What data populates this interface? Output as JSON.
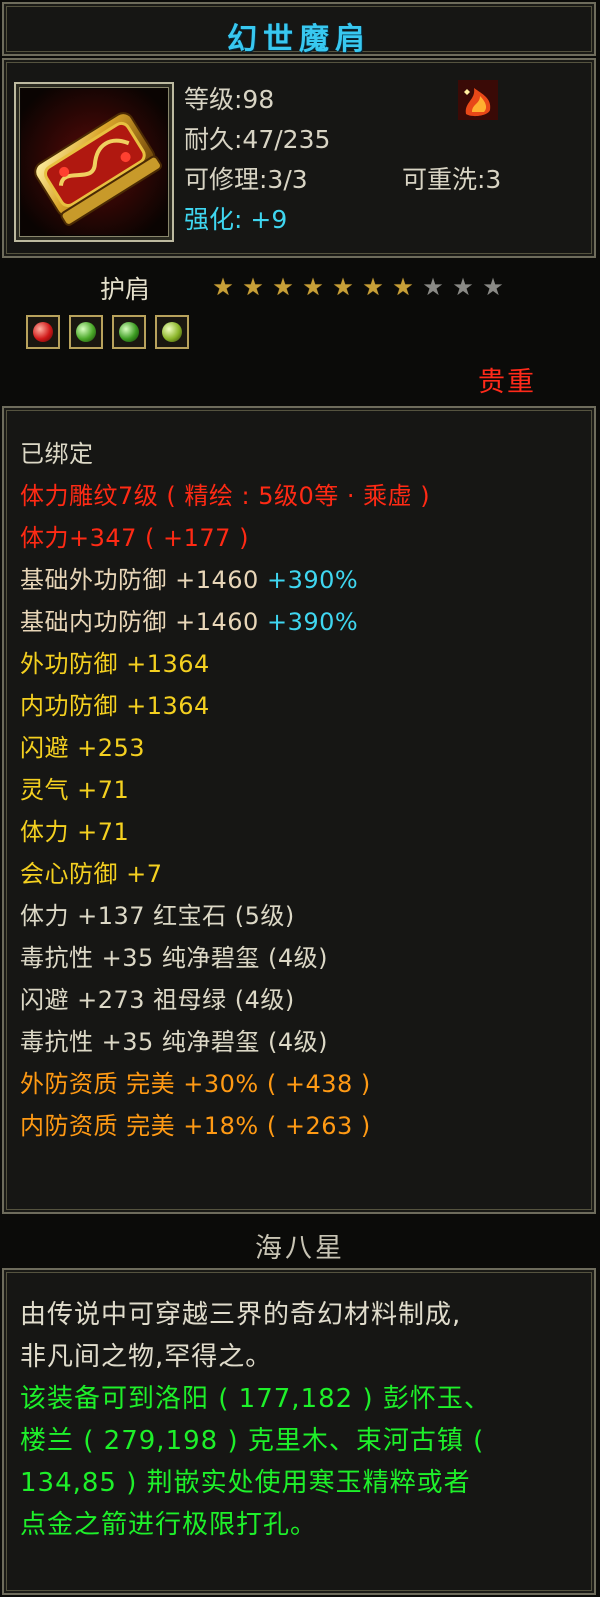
{
  "item": {
    "name": "幻世魔肩",
    "level": "等级:98",
    "durability": "耐久:47/235",
    "repairable": "可修理:3/3",
    "rewashable": "可重洗:3",
    "enhance": "强化: +9",
    "slot_type": "护肩",
    "stars_total": 10,
    "stars_filled": 7,
    "rarity": "贵重",
    "gem_slots": [
      "red",
      "green",
      "green",
      "yellow-green"
    ],
    "icon": "golden-shoulder-armor-icon",
    "mini_icon": "flame-buff-icon"
  },
  "attributes": {
    "bound": "已绑定",
    "engrave": "体力雕纹7级 ( 精绘 : 5级0等 · 乘虚 )",
    "vit_bonus": "体力+347 ( +177 )",
    "base_ext_def": "基础外功防御 +1460 ",
    "base_ext_def_pct": "+390%",
    "base_int_def": "基础内功防御 +1460 ",
    "base_int_def_pct": "+390%",
    "ext_def": "外功防御 +1364",
    "int_def": "内功防御 +1364",
    "dodge": "闪避 +253",
    "spirit": "灵气 +71",
    "vit": "体力 +71",
    "crit_def": "会心防御 +7",
    "gem1": "体力 +137 红宝石 (5级)",
    "gem2": "毒抗性 +35 纯净碧玺 (4级)",
    "gem3": "闪避 +273 祖母绿 (4级)",
    "gem4": "毒抗性 +35 纯净碧玺 (4级)",
    "apt_ext": "外防资质  完美 +30% ( +438 )",
    "apt_int": "内防资质  完美 +18% ( +263 )"
  },
  "set_name": "海八星",
  "description": {
    "line1": "由传说中可穿越三界的奇幻材料制成,",
    "line2": "非凡间之物,罕得之。",
    "line3": "该装备可到洛阳 ( 177,182 ) 彭怀玉、",
    "line4": "楼兰 ( 279,198 ) 克里木、束河古镇 (",
    "line5": "134,85 ) 荆嵌实处使用寒玉精粹或者",
    "line6": "点金之箭进行极限打孔。"
  },
  "colors": {
    "title": "#38c8f0",
    "red": "#ff2a14",
    "orange": "#ff9a14",
    "yellow": "#f4d020",
    "cyan": "#3fd6f0",
    "green": "#1ef02a"
  }
}
